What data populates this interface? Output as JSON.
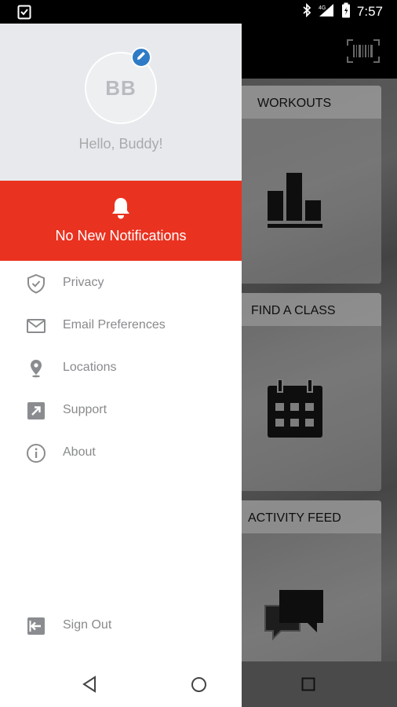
{
  "status_bar": {
    "time": "7:57",
    "network": "4G",
    "icons": [
      "clipboard-check-icon",
      "bluetooth-icon",
      "signal-icon",
      "battery-icon"
    ]
  },
  "drawer": {
    "avatar_initials": "BB",
    "greeting": "Hello, Buddy!",
    "notifications_text": "No New Notifications",
    "menu": [
      {
        "label": "Privacy",
        "icon": "shield-check-icon"
      },
      {
        "label": "Email Preferences",
        "icon": "mail-icon"
      },
      {
        "label": "Locations",
        "icon": "location-pin-icon"
      },
      {
        "label": "Support",
        "icon": "external-link-icon"
      },
      {
        "label": "About",
        "icon": "info-icon"
      }
    ],
    "sign_out": {
      "label": "Sign Out",
      "icon": "sign-out-icon"
    }
  },
  "tiles": [
    {
      "label": "WORKOUTS",
      "icon": "bar-chart-icon"
    },
    {
      "label": "FIND A CLASS",
      "icon": "calendar-icon"
    },
    {
      "label": "ACTIVITY FEED",
      "icon": "chat-bubbles-icon"
    }
  ],
  "colors": {
    "accent": "#ea3220",
    "edit_badge": "#2f7bc6",
    "header_bg": "#e8e9ec"
  }
}
